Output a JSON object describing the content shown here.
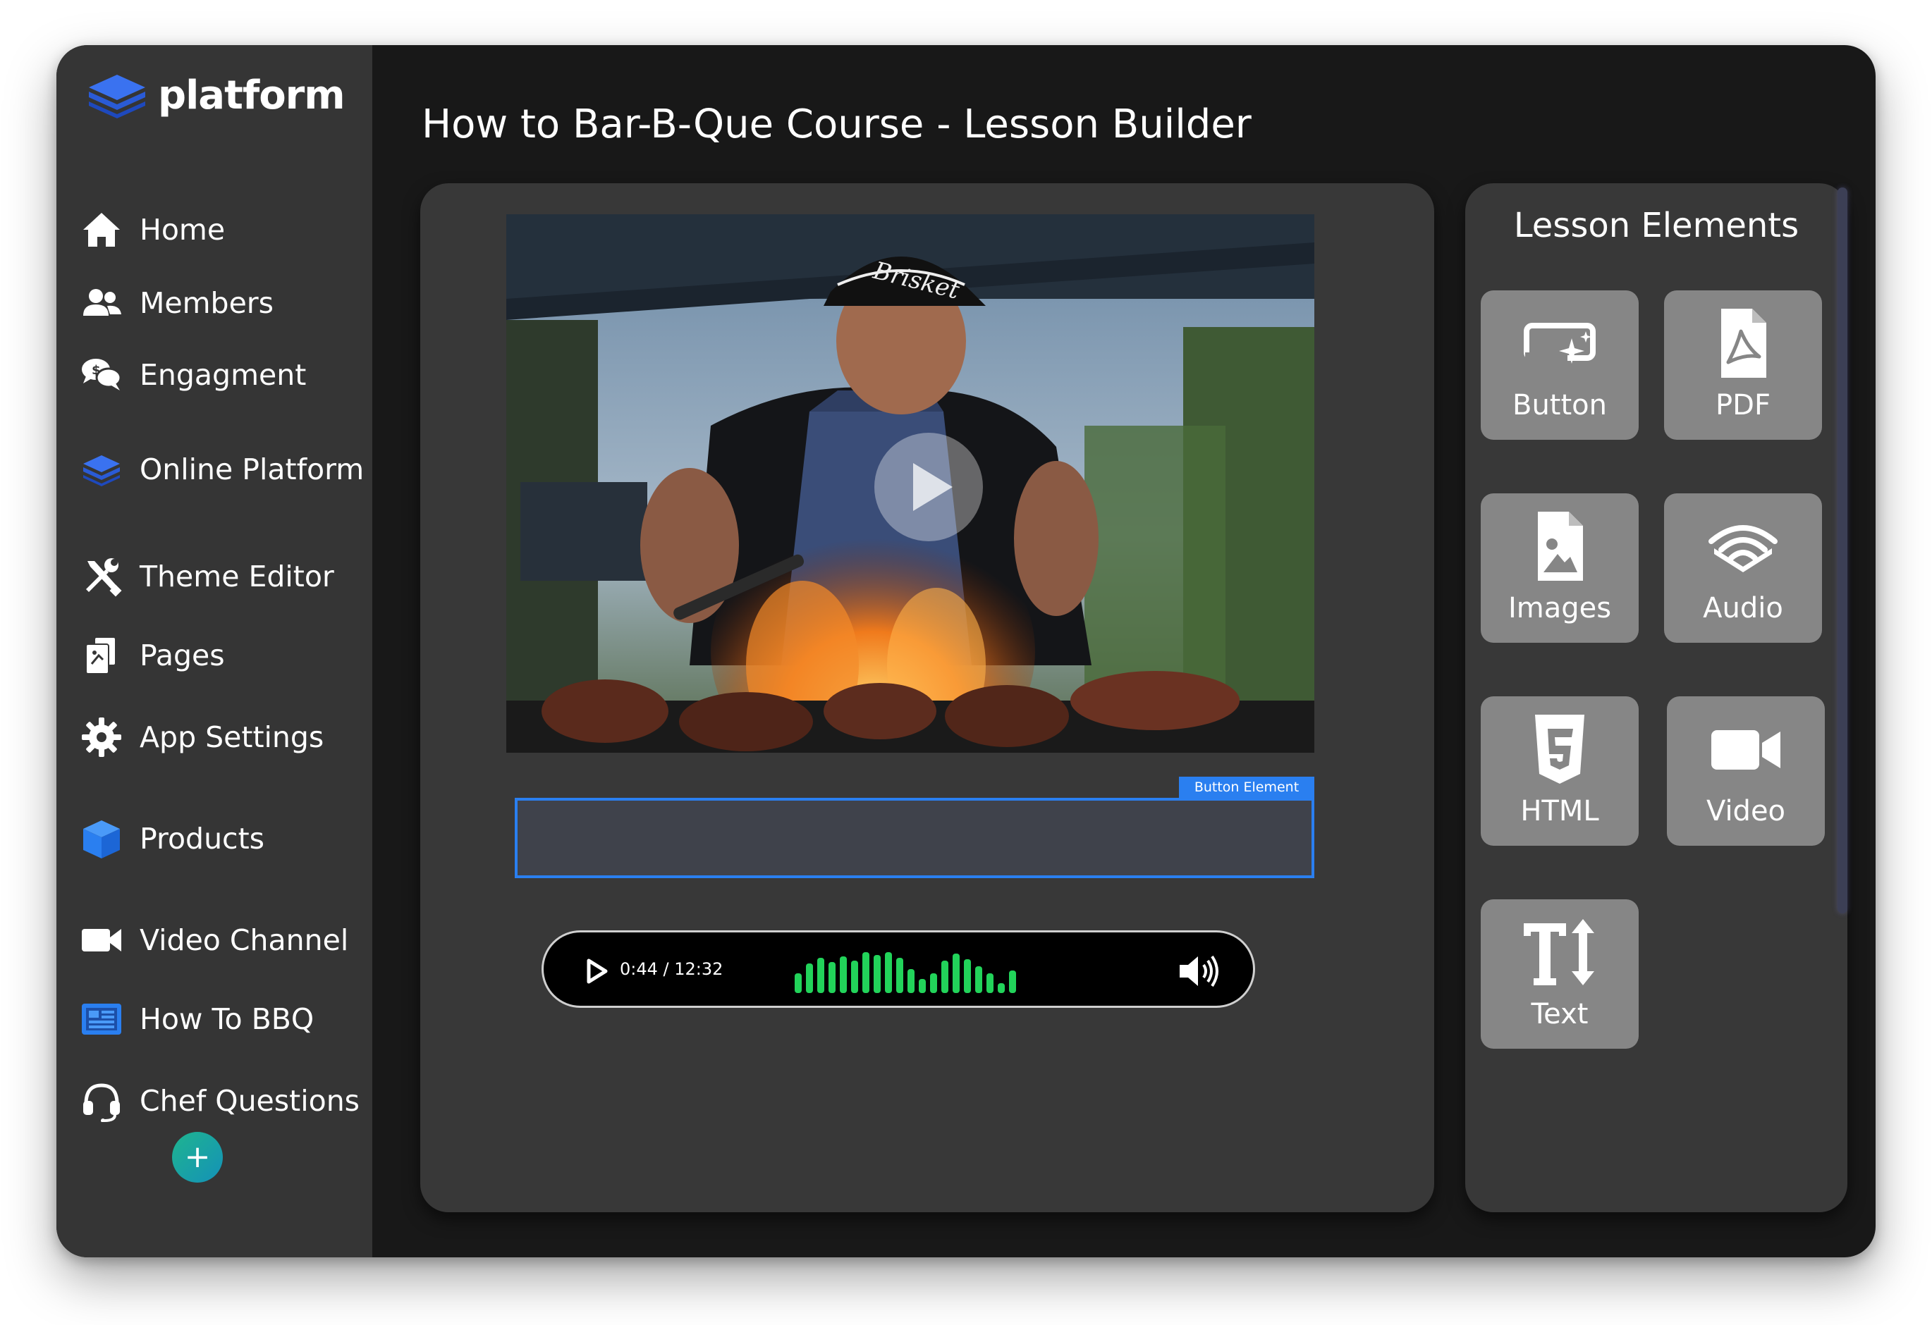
{
  "app": {
    "logo_text": "platform",
    "logo_icon": "stacked-layers-logo"
  },
  "sidebar": {
    "items": [
      {
        "label": "Home",
        "icon": "home-icon"
      },
      {
        "label": "Members",
        "icon": "users-icon"
      },
      {
        "label": "Engagment",
        "icon": "comments-dollar-icon"
      },
      {
        "label": "Online Platform",
        "icon": "stacked-layers-icon"
      },
      {
        "label": "Theme Editor",
        "icon": "tools-icon"
      },
      {
        "label": "Pages",
        "icon": "pages-icon"
      },
      {
        "label": "App Settings",
        "icon": "gear-icon"
      },
      {
        "label": "Products",
        "icon": "cube-icon"
      },
      {
        "label": "Video Channel",
        "icon": "video-camera-icon"
      },
      {
        "label": "How To BBQ",
        "icon": "newspaper-icon"
      },
      {
        "label": "Chef Questions",
        "icon": "headset-icon"
      }
    ],
    "add_button": "+"
  },
  "main": {
    "title": "How to Bar-B-Que Course - Lesson Builder",
    "button_element_tag": "Button Element",
    "audio_player": {
      "time": "0:44 / 12:32"
    }
  },
  "elements_panel": {
    "title": "Lesson Elements",
    "tiles": [
      {
        "label": "Button",
        "icon": "button-sparkle-icon"
      },
      {
        "label": "PDF",
        "icon": "pdf-file-icon"
      },
      {
        "label": "Images",
        "icon": "image-file-icon"
      },
      {
        "label": "Audio",
        "icon": "audio-waves-icon"
      },
      {
        "label": "HTML",
        "icon": "html5-icon"
      },
      {
        "label": "Video",
        "icon": "video-camera-icon"
      },
      {
        "label": "Text",
        "icon": "text-height-icon"
      }
    ]
  },
  "colors": {
    "accent_blue": "#2a7ff0",
    "audio_wave_green": "#22d35a",
    "fab_teal": "#1fb58f"
  }
}
